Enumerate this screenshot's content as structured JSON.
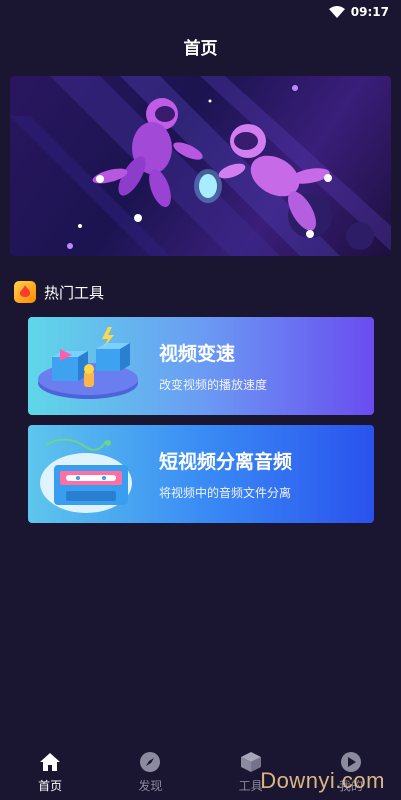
{
  "status_bar": {
    "time": "09:17"
  },
  "header": {
    "title": "首页"
  },
  "section": {
    "title": "热门工具"
  },
  "cards": [
    {
      "title": "视频变速",
      "subtitle": "改变视频的播放速度"
    },
    {
      "title": "短视频分离音频",
      "subtitle": "将视频中的音频文件分离"
    }
  ],
  "tabs": [
    {
      "label": "首页",
      "icon": "home-icon",
      "active": true
    },
    {
      "label": "发现",
      "icon": "compass-icon",
      "active": false
    },
    {
      "label": "工具",
      "icon": "cube-icon",
      "active": false
    },
    {
      "label": "我的",
      "icon": "play-circle-icon",
      "active": false
    }
  ],
  "watermark": "Downyi.com",
  "colors": {
    "background": "#1a1530",
    "accent": "#6a4cf0"
  }
}
